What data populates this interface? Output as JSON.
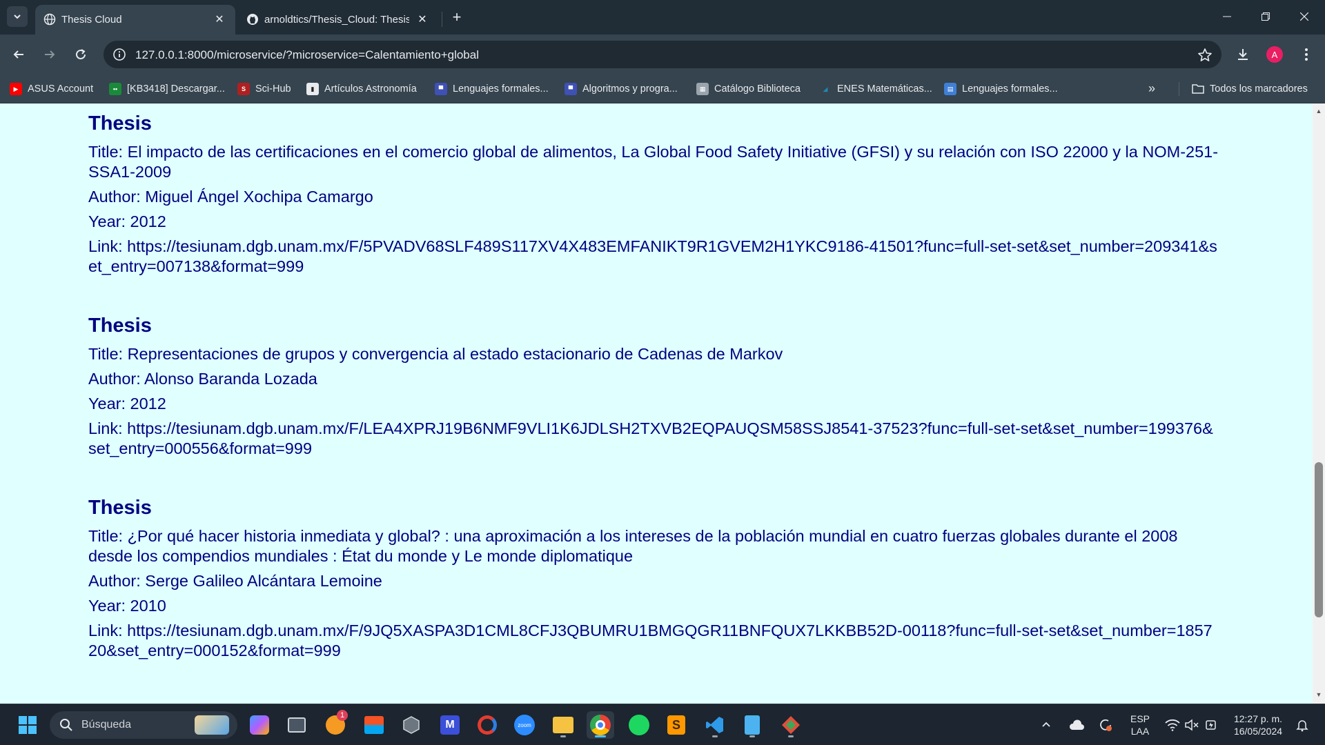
{
  "browser": {
    "tabs": [
      {
        "title": "Thesis Cloud",
        "active": true,
        "icon": "globe-icon"
      },
      {
        "title": "arnoldtics/Thesis_Cloud: Thesis",
        "active": false,
        "icon": "github-icon"
      }
    ],
    "new_tab_label": "+",
    "address": "127.0.0.1:8000/microservice/?microservice=Calentamiento+global",
    "profile_initial": "A",
    "bookmarks": [
      {
        "label": "ASUS Account",
        "icon": "youtube-icon",
        "color": "#ff0000"
      },
      {
        "label": "[KB3418] Descargar...",
        "icon": "asus-icon",
        "color": "#1a8a3a"
      },
      {
        "label": "Sci-Hub",
        "icon": "scihub-icon",
        "color": "#b02020"
      },
      {
        "label": "Artículos Astronomía",
        "icon": "book-icon",
        "color": "#e8eaed"
      },
      {
        "label": "Lenguajes formales...",
        "icon": "site-icon",
        "color": "#3f51b5"
      },
      {
        "label": "Algoritmos y progra...",
        "icon": "site-icon",
        "color": "#3f51b5"
      },
      {
        "label": "Catálogo Biblioteca",
        "icon": "catalog-icon",
        "color": "#9aa4ad"
      },
      {
        "label": "ENES Matemáticas...",
        "icon": "leaf-icon",
        "color": "#1e6b8a"
      },
      {
        "label": "Lenguajes formales...",
        "icon": "doc-icon",
        "color": "#3f7fd6"
      }
    ],
    "all_bookmarks_label": "Todos los marcadores"
  },
  "page": {
    "theses": [
      {
        "heading": "Thesis",
        "title": "Title: El impacto de las certificaciones en el comercio global de alimentos, La Global Food Safety Initiative (GFSI) y su relación con ISO 22000 y la NOM-251-SSA1-2009",
        "author": "Author: Miguel Ángel Xochipa Camargo",
        "year": "Year: 2012",
        "link": "Link: https://tesiunam.dgb.unam.mx/F/5PVADV68SLF489S117XV4X483EMFANIKT9R1GVEM2H1YKC9186-41501?func=full-set-set&set_number=209341&set_entry=007138&format=999"
      },
      {
        "heading": "Thesis",
        "title": "Title: Representaciones de grupos y convergencia al estado estacionario de Cadenas de Markov",
        "author": "Author: Alonso Baranda Lozada",
        "year": "Year: 2012",
        "link": "Link: https://tesiunam.dgb.unam.mx/F/LEA4XPRJ19B6NMF9VLI1K6JDLSH2TXVB2EQPAUQSM58SSJ8541-37523?func=full-set-set&set_number=199376&set_entry=000556&format=999"
      },
      {
        "heading": "Thesis",
        "title": "Title: ¿Por qué hacer historia inmediata y global? : una aproximación a los intereses de la población mundial en cuatro fuerzas globales durante el 2008 desde los compendios mundiales : État du monde y Le monde diplomatique",
        "author": "Author: Serge Galileo Alcántara Lemoine",
        "year": "Year: 2010",
        "link": "Link: https://tesiunam.dgb.unam.mx/F/9JQ5XASPA3D1CML8CFJ3QBUMRU1BMGQGR11BNFQUX7LKKBB52D-00118?func=full-set-set&set_number=185720&set_entry=000152&format=999"
      }
    ],
    "text_color": "#000080",
    "background": "#e0ffff"
  },
  "taskbar": {
    "search_placeholder": "Búsqueda",
    "notification_badge": "1",
    "lang_top": "ESP",
    "lang_bottom": "LAA",
    "time": "12:27 p. m.",
    "date": "16/05/2024"
  }
}
